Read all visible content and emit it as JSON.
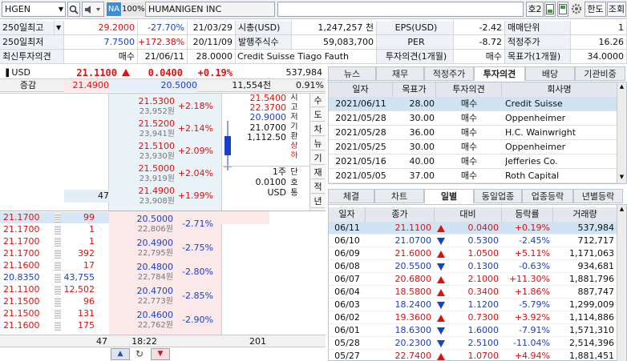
{
  "toolbar": {
    "symbol": "HGEN",
    "na_badge": "NA",
    "zoom": "100%",
    "company": "HUMANIGEN INC",
    "screen_no": "호2",
    "lang_btn": "한도",
    "query_btn": "조회"
  },
  "info": {
    "r1": {
      "l1": "250일최고",
      "v1": "29.2000",
      "v2": "-27.70%",
      "v3": "21/03/29",
      "l2": "시총(USD)",
      "v4": "1,247,257 천",
      "l3": "EPS(USD)",
      "v5": "-2.42",
      "l4": "매매단위",
      "v6": "1"
    },
    "r2": {
      "l1": "250일최저",
      "v1": "7.7500",
      "v2": "+172.38%",
      "v3": "20/11/09",
      "l2": "발행주식수",
      "v4": "59,083,700",
      "l3": "PER",
      "v5": "-8.72",
      "l4": "적정주가",
      "v6": "16.26"
    },
    "r3": {
      "l1": "최신투자의견",
      "v1": "매수",
      "v3": "21/06/11",
      "v2": "28.0000",
      "v4": "Credit Suisse Tiago Fauth",
      "l3": "투자의견(1개월)",
      "v5": "매수",
      "l4": "목표가(1개월)",
      "v6": "34.0000"
    }
  },
  "price": {
    "currency": "USD",
    "last": "21.1100",
    "change": "0.0400",
    "rate": "+0.19%",
    "volume": "537,984",
    "label_chg": "증감",
    "ask_total": "21.4900",
    "bid_total": "20.5000",
    "qty": "11,554천",
    "ratio": "0.91%"
  },
  "asks": [
    {
      "price": "21.5300",
      "won": "23,952원",
      "rate": "+2.18%"
    },
    {
      "price": "21.5200",
      "won": "23,941원",
      "rate": "+2.14%"
    },
    {
      "price": "21.5100",
      "won": "23,930원",
      "rate": "+2.09%"
    },
    {
      "price": "21.5000",
      "won": "23,919원",
      "rate": "+2.04%"
    },
    {
      "price": "21.4900",
      "won": "23,908원",
      "rate": "+1.99%",
      "qty": "47"
    }
  ],
  "bids": [
    {
      "price": "20.5000",
      "won": "22,806원",
      "rate": "-2.71%",
      "qty": "201"
    },
    {
      "price": "20.4900",
      "won": "22,795원",
      "rate": "-2.75%"
    },
    {
      "price": "20.4800",
      "won": "22,784원",
      "rate": "-2.80%"
    },
    {
      "price": "20.4700",
      "won": "22,773원",
      "rate": "-2.85%"
    },
    {
      "price": "20.4600",
      "won": "22,762원",
      "rate": "-2.90%"
    }
  ],
  "candle_info": {
    "high": "21.5400",
    "close": "22.3700",
    "low": "20.9000",
    "base": "21.0700",
    "fx": "1,112.50",
    "unit": "1주",
    "tick": "0.0100",
    "cur": "USD"
  },
  "candle_labels": [
    "시",
    "고",
    "저",
    "기",
    "환",
    "상",
    "하"
  ],
  "candle_right_labels": [
    "단",
    "호",
    "통"
  ],
  "side_buttons": [
    "수",
    "도",
    "차",
    "뉴",
    "기",
    "재",
    "적",
    "년"
  ],
  "ticks": [
    {
      "price": "21.1700",
      "qty": "99"
    },
    {
      "price": "21.1700",
      "qty": "1"
    },
    {
      "price": "21.1700",
      "qty": "1"
    },
    {
      "price": "21.1700",
      "qty": "392"
    },
    {
      "price": "21.1600",
      "qty": "17"
    },
    {
      "price": "20.8350",
      "qty": "43,755"
    },
    {
      "price": "21.1100",
      "qty": "12,502"
    },
    {
      "price": "21.1500",
      "qty": "96"
    },
    {
      "price": "21.1500",
      "qty": "131"
    },
    {
      "price": "21.1600",
      "qty": "175"
    }
  ],
  "book_footer": {
    "ask_sum": "47",
    "time": "18:22",
    "bid_sum": "201"
  },
  "top_tabs": [
    "뉴스",
    "재무",
    "적정주가",
    "투자의견",
    "배당",
    "기관비중"
  ],
  "opinion": {
    "headers": [
      "일자",
      "목표가",
      "투자의견",
      "회사명"
    ],
    "rows": [
      {
        "date": "2021/06/11",
        "target": "28.00",
        "op": "매수",
        "firm": "Credit Suisse"
      },
      {
        "date": "2021/05/28",
        "target": "30.00",
        "op": "매수",
        "firm": "Oppenheimer"
      },
      {
        "date": "2021/05/28",
        "target": "36.00",
        "op": "매수",
        "firm": "H.C. Wainwright"
      },
      {
        "date": "2021/05/25",
        "target": "30.00",
        "op": "매수",
        "firm": "Oppenheimer"
      },
      {
        "date": "2021/05/16",
        "target": "40.00",
        "op": "매수",
        "firm": "Jefferies  Co."
      },
      {
        "date": "2021/05/05",
        "target": "37.00",
        "op": "매수",
        "firm": "Roth Capital"
      }
    ]
  },
  "bottom_tabs": [
    "체결",
    "차트",
    "일별",
    "동일업종",
    "업종등락",
    "년별등락"
  ],
  "daily": {
    "headers": [
      "일자",
      "종가",
      "대비",
      "등락률",
      "거래량"
    ],
    "rows": [
      {
        "date": "06/11",
        "close": "21.1100",
        "dir": "up",
        "diff": "0.0400",
        "rate": "+0.19%",
        "vol": "537,984"
      },
      {
        "date": "06/10",
        "close": "21.0700",
        "dir": "dn",
        "diff": "0.5300",
        "rate": "-2.45%",
        "vol": "712,717"
      },
      {
        "date": "06/09",
        "close": "21.6000",
        "dir": "up",
        "diff": "1.0500",
        "rate": "+5.11%",
        "vol": "1,171,063"
      },
      {
        "date": "06/08",
        "close": "20.5500",
        "dir": "dn",
        "diff": "0.1300",
        "rate": "-0.63%",
        "vol": "934,681"
      },
      {
        "date": "06/07",
        "close": "20.6800",
        "dir": "up",
        "diff": "2.1000",
        "rate": "+11.30%",
        "vol": "1,881,796"
      },
      {
        "date": "06/04",
        "close": "18.5800",
        "dir": "up",
        "diff": "0.3400",
        "rate": "+1.86%",
        "vol": "887,747"
      },
      {
        "date": "06/03",
        "close": "18.2400",
        "dir": "dn",
        "diff": "1.1200",
        "rate": "-5.79%",
        "vol": "1,299,009"
      },
      {
        "date": "06/02",
        "close": "19.3600",
        "dir": "up",
        "diff": "0.7300",
        "rate": "+3.92%",
        "vol": "1,114,886"
      },
      {
        "date": "06/01",
        "close": "18.6300",
        "dir": "dn",
        "diff": "1.6000",
        "rate": "-7.91%",
        "vol": "1,571,310"
      },
      {
        "date": "05/28",
        "close": "20.2300",
        "dir": "dn",
        "diff": "2.5100",
        "rate": "-11.04%",
        "vol": "2,514,396"
      },
      {
        "date": "05/27",
        "close": "22.7400",
        "dir": "up",
        "diff": "1.0700",
        "rate": "+4.94%",
        "vol": "1,881,451"
      }
    ]
  }
}
